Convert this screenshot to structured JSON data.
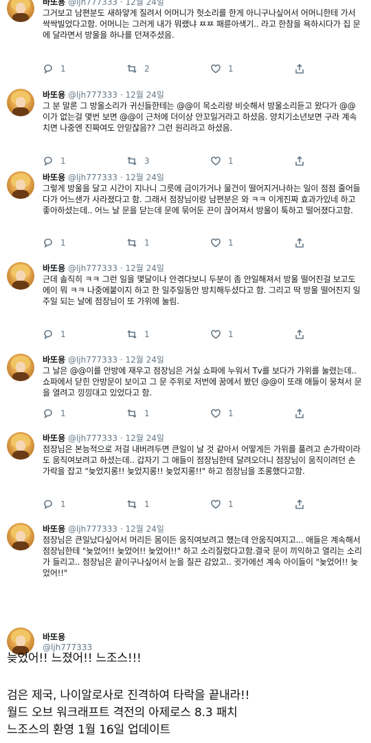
{
  "tweets": [
    {
      "name": "바또용",
      "handle": "@ljh777333",
      "dot": "·",
      "date": "12월 24일",
      "text": "그거보고 남편분도 새하얗게 질려서 어머니가 헛소리를 한게 아니구나싶어서 어머니한테 가서 싹싹빌었다고함. 어머니는 그러게 내가 뭐랬냐 ㅉㅉ 패륜아색기.. 라고 한참을 욕하시다가 집 문에 달라면서 방울을 하나를 던져주셨음.",
      "replies": "1",
      "retweets": "2",
      "likes": "1"
    },
    {
      "name": "바또용",
      "handle": "@ljh777333",
      "dot": "·",
      "date": "12월 24일",
      "text": "그 분 말론 그 방울소리가 귀신들한테는 @@이 목소리랑 비슷해서 방울소리듣고 왔다가 @@이가 없는걸 몇번 보면 @@이 근처에 더이상 안꼬일거라고 하셨음. 양치기소년보면 구라 계속치면 나중엔 진짜여도 안믿잖음?? 그런 원리라고 하셨음.",
      "replies": "1",
      "retweets": "3",
      "likes": "1"
    },
    {
      "name": "바또용",
      "handle": "@ljh777333",
      "dot": "·",
      "date": "12월 24일",
      "text": "그렇게 방울을 달고 시간이 지나니 그릇에 금이가거나 물건이 떨어지거나하는 일이 점점 줄어들다가 어느샌가 사라졌다고 함. 그래서 점장님이랑 남편분은 와 ㅋㅋ 이게진짜 효과가있네 하고 좋아하셨는데.. 어느 날 문을 닫는데 문에 묶어둔 끈이 끊어져서 방울이 툭하고 떨어졌다고함.",
      "replies": "1",
      "retweets": "1",
      "likes": "1"
    },
    {
      "name": "바또용",
      "handle": "@ljh777333",
      "dot": "·",
      "date": "12월 24일",
      "text": "근데 솔직히 ㅋㅋ 그런 일을 몇달이나 안겪다보니 두분이 좀 안일해져서 방울 떨어진걸 보고도 에이 뭐 ㅋㅋ 나중에붙이지 하고 한 일주일동안 방치해두셨다고 함. 그리고 딱 방울 떨어진지 일주일 되는 날에 점장님이 또 가위에 눌림.",
      "replies": "1",
      "retweets": "1",
      "likes": "1"
    },
    {
      "name": "바또용",
      "handle": "@ljh777333",
      "dot": "·",
      "date": "12월 24일",
      "text": "그 날은 @@이를 안방에 재우고 점장님은 거실 쇼파에 누워서 Tv를 보다가 가위를 눌렸는데.. 쇼파에서 닫힌 안방문이 보이고 그 문 주위로 저번에 꿈에서 봤던 @@이 또래 애들이 뭉쳐서 문을 열려고 낑낑대고 있었다고 함.",
      "replies": "1",
      "retweets": "1",
      "likes": "1"
    },
    {
      "name": "바또용",
      "handle": "@ljh777333",
      "dot": "·",
      "date": "12월 24일",
      "text": "점장님은 본능적으로 저걸 내버려두면 큰일이 날 것 같아서 어떻게든 가위를 풀려고 손가락이라도 움직여보려고 하셨는데.. 갑자기 그 애들이 점장님한테 달려오더니 점장님이 움직이려던 손가락을 잡고 \"늦었지롱!! 늦었지롱!! 늦었지롱!!\" 하고 점장님을 조롱했다고함.",
      "replies": "1",
      "retweets": "1",
      "likes": "1"
    },
    {
      "name": "바또용",
      "handle": "@ljh777333",
      "dot": "·",
      "date": "12월 24일",
      "text": "점장님은 큰일났다싶어서 머리든 몸이든 움직여보려고 했는데 안움직여지고... 애들은 계속해서 점장님한테 \"늦었어!! 늦었어!! 늦었어!!\" 하고 소리질렀다고함.결국 문이 끼익하고 열리는 소리가 들리고.. 점장님은 끝이구나싶어서 눈을 질끈 감았고.. 귓가에선 계속 아이들이 \"늦었어!! 늦었어!!\"",
      "replies": "1",
      "retweets": "1",
      "likes": "1"
    }
  ],
  "last_tweet": {
    "name": "바또용",
    "handle": "@ljh777333"
  },
  "big_text": [
    "늦었어!! 느졌어!! 느조스!!!",
    "검은 제국, 나이알로사로 진격하여 타락을 끝내라!!",
    "월드 오브 워크래프트 격전의 아제로스 8.3 패치",
    "느조스의 환영 1월 16일 업데이트"
  ],
  "icons": {
    "reply": "reply-icon",
    "retweet": "retweet-icon",
    "like": "heart-icon",
    "share": "share-icon"
  }
}
